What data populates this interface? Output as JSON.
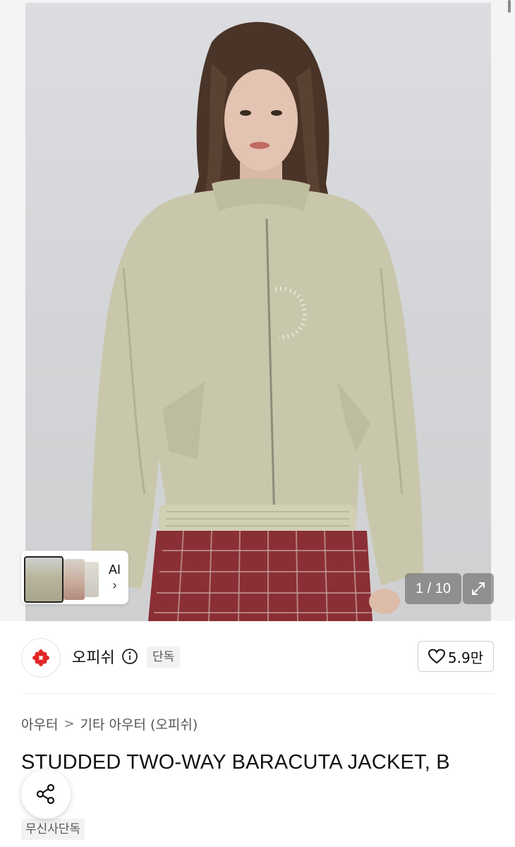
{
  "gallery": {
    "counter": "1 / 10",
    "ai_label": "AI",
    "ai_chevron": "›",
    "expand_icon": "expand-icon"
  },
  "brand": {
    "name": "오피쉬",
    "exclusive_badge": "단독",
    "like_count": "5.9만",
    "logo_color": "#e32626"
  },
  "breadcrumb": {
    "items": [
      "아우터",
      "기타 아우터 (오피쉬)"
    ],
    "separator": ">"
  },
  "product": {
    "title": "STUDDED TWO-WAY BARACUTA JACKET, B",
    "musinsa_badge": "무신사단독"
  },
  "colors": {
    "jacket": "#c9c7ab",
    "skirt": "#8a2f35",
    "hair": "#4a3428",
    "background": "#d6d7da"
  }
}
